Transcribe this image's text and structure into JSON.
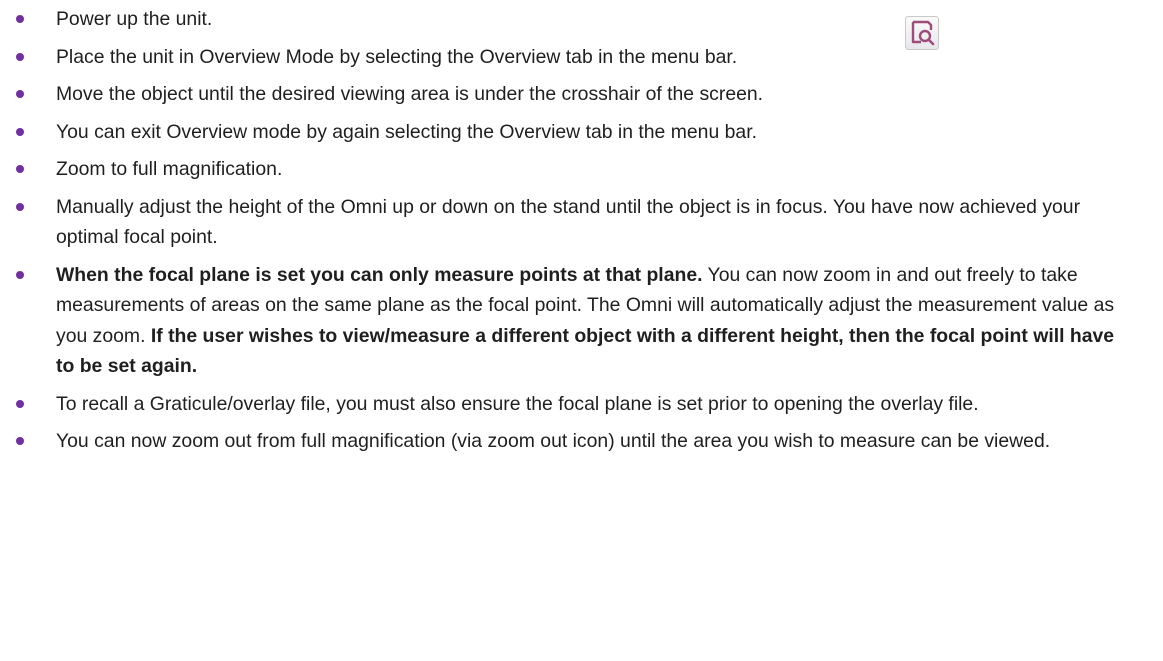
{
  "icons": {
    "overview_icon": "overview-tab-icon",
    "bullet": "purple-dot",
    "accent_color": "#7030a0"
  },
  "steps": [
    {
      "text": "Power up the unit."
    },
    {
      "text": "Place the unit in Overview Mode by selecting the Overview tab in the menu bar."
    },
    {
      "text": "Move the object until the desired viewing area is under the crosshair of the screen."
    },
    {
      "text": "You can exit Overview mode by again selecting the Overview tab in the menu bar."
    },
    {
      "text": "Zoom to full magnification."
    },
    {
      "text": "Manually adjust the height of the Omni up or down on the stand until the object is in focus. You have now achieved your optimal focal point."
    },
    {
      "bold_intro": "When the focal plane is set you can only measure points at that plane.",
      "text": " You can now zoom in and out freely to take measurements of areas on the same plane as the focal point. The Omni will automatically adjust the measurement value as you zoom.  ",
      "bold_outro": "If the user wishes to view/measure a different object with a different height, then the focal point will have to be set again."
    },
    {
      "text": "To recall a Graticule/overlay file, you must also ensure the focal plane is set prior to opening the overlay file."
    },
    {
      "text": "You can now zoom out from full magnification (via zoom out icon) until the area you wish to measure can be viewed."
    }
  ]
}
